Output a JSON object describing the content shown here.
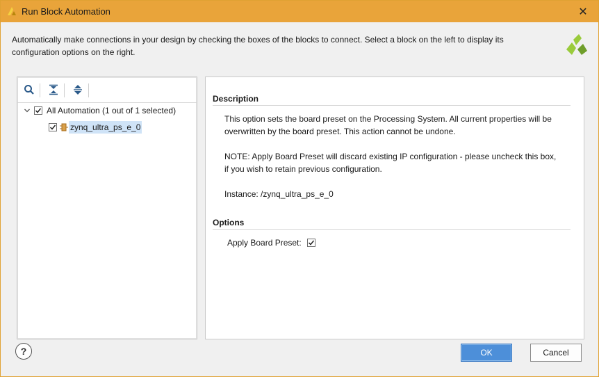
{
  "window": {
    "title": "Run Block Automation",
    "close_glyph": "✕",
    "title_bar_color": "#e9a43a"
  },
  "intro": {
    "line1": "Automatically make connections in your design by checking the boxes of the blocks to connect. Select a block on the left to display its",
    "line2": "configuration options on the right."
  },
  "tree": {
    "root": {
      "label": "All Automation (1 out of 1 selected)",
      "checked": true,
      "expanded": true
    },
    "children": [
      {
        "label": "zynq_ultra_ps_e_0",
        "checked": true,
        "selected": true
      }
    ]
  },
  "toolbar": {
    "icons": [
      "search-icon",
      "collapse-all-icon",
      "expand-all-icon"
    ]
  },
  "description": {
    "heading": "Description",
    "para1_line1": "This option sets the board preset on the Processing System. All current properties will be",
    "para1_line2": "overwritten by the board preset. This action cannot be undone.",
    "para2_line1": "NOTE: Apply Board Preset will discard existing IP configuration - please uncheck this box,",
    "para2_line2": "if you wish to retain previous configuration.",
    "instance": "Instance: /zynq_ultra_ps_e_0"
  },
  "options": {
    "heading": "Options",
    "apply_board_preset_label": "Apply Board Preset:",
    "apply_board_preset_checked": true
  },
  "footer": {
    "help_glyph": "?",
    "ok_label": "OK",
    "cancel_label": "Cancel"
  },
  "colors": {
    "accent": "#4d8fd9",
    "selection": "#cfe3f7"
  }
}
